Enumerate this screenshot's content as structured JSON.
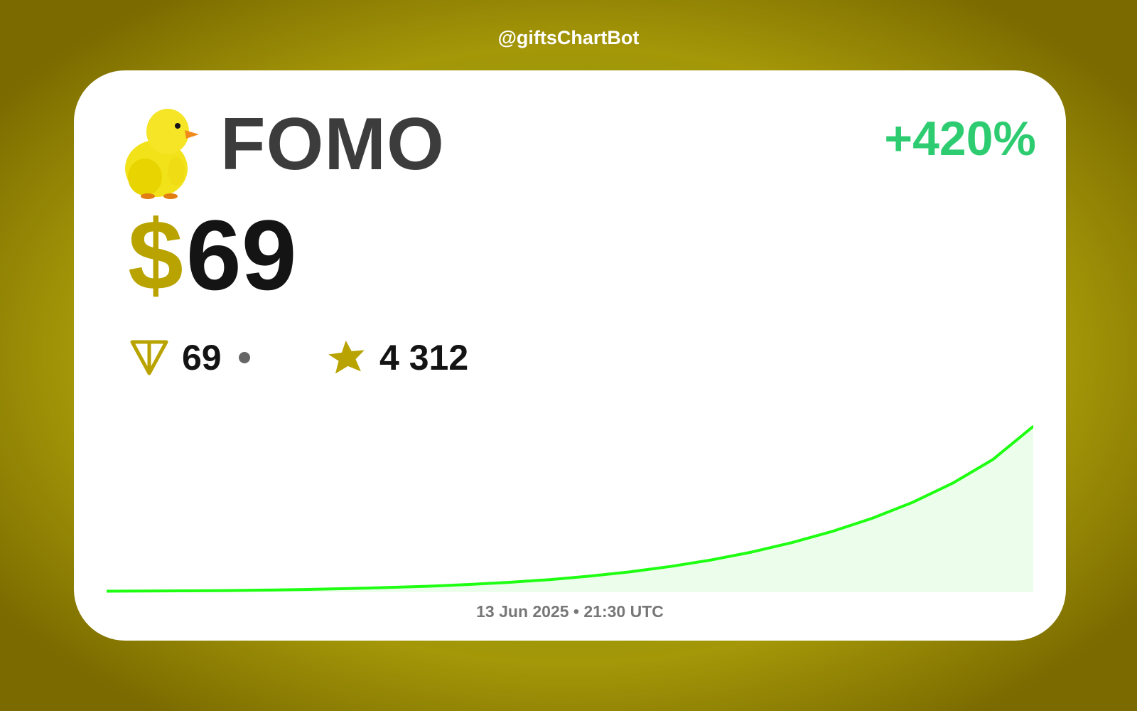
{
  "header": {
    "handle": "@giftsChartBot"
  },
  "gift": {
    "name": "FOMO",
    "icon": "yellow-duck-icon",
    "change": "+420%",
    "price_currency": "$",
    "price_value": "69"
  },
  "stats": {
    "ton_icon": "ton-icon",
    "ton_value": "69",
    "stars_icon": "telegram-star-icon",
    "stars_value": "4 312"
  },
  "footer": {
    "timestamp": "13 Jun 2025 • 21:30 UTC"
  },
  "colors": {
    "accent": "#b8a300",
    "positive": "#2ecc71",
    "line": "#1eff12",
    "area": "#ecfdec"
  },
  "chart_data": {
    "type": "area",
    "title": "",
    "xlabel": "",
    "ylabel": "",
    "grid": false,
    "legend": "none",
    "x": [
      0,
      1,
      2,
      3,
      4,
      5,
      6,
      7,
      8,
      9,
      10,
      11,
      12,
      13,
      14,
      15,
      16,
      17,
      18,
      19,
      20,
      21,
      22,
      23
    ],
    "series": [
      {
        "values": [
          1.0,
          1.1,
          1.3,
          1.6,
          2.0,
          2.6,
          3.4,
          4.4,
          5.6,
          7.2,
          9.2,
          11.7,
          14.9,
          18.9,
          23.8,
          29.8,
          37.0,
          45.7,
          56.0,
          68.2,
          82.8,
          100.6,
          122.5,
          153.0
        ]
      }
    ],
    "ylim": [
      0,
      160
    ]
  }
}
